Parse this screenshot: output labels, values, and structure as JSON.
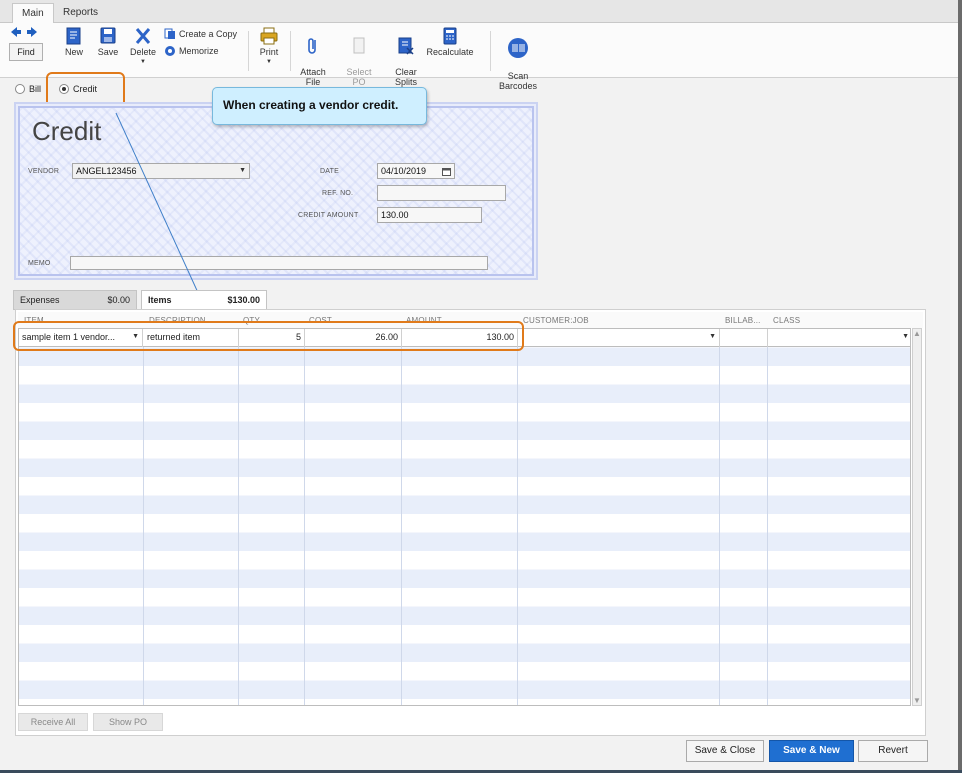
{
  "ribbon": {
    "tabs": [
      {
        "label": "Main"
      },
      {
        "label": "Reports"
      }
    ],
    "find_label": "Find",
    "new_label": "New",
    "save_label": "Save",
    "delete_label": "Delete",
    "create_copy_label": "Create a Copy",
    "memorize_label": "Memorize",
    "print_label": "Print",
    "attach_file_label": "Attach\nFile",
    "select_po_label": "Select\nPO",
    "clear_splits_label": "Clear\nSplits",
    "recalculate_label": "Recalculate",
    "scan_barcodes_label": "Scan\nBarcodes"
  },
  "type_selector": {
    "bill_label": "Bill",
    "credit_label": "Credit",
    "selected": "Credit"
  },
  "callout": {
    "text": "When creating a vendor credit."
  },
  "form": {
    "title": "Credit",
    "vendor_label": "VENDOR",
    "vendor_value": "ANGEL123456",
    "date_label": "DATE",
    "date_value": "04/10/2019",
    "ref_label": "REF. NO.",
    "ref_value": "",
    "credit_amount_label": "CREDIT AMOUNT",
    "credit_amount_value": "130.00",
    "memo_label": "MEMO",
    "memo_value": ""
  },
  "subtabs": {
    "expenses_label": "Expenses",
    "expenses_amount": "$0.00",
    "items_label": "Items",
    "items_amount": "$130.00"
  },
  "grid": {
    "columns": [
      "ITEM",
      "DESCRIPTION",
      "QTY",
      "COST",
      "AMOUNT",
      "CUSTOMER:JOB",
      "BILLAB...",
      "CLASS"
    ],
    "rows": [
      {
        "item": "sample item 1 vendor...",
        "description": "returned item",
        "qty": "5",
        "cost": "26.00",
        "amount": "130.00",
        "customer_job": "",
        "billable": "",
        "class": ""
      }
    ]
  },
  "grid_buttons": {
    "receive_all": "Receive All",
    "show_po": "Show PO"
  },
  "actions": {
    "save_close": "Save & Close",
    "save_new": "Save & New",
    "revert": "Revert"
  }
}
